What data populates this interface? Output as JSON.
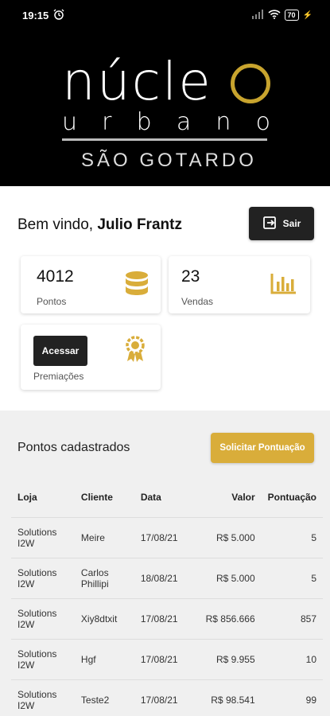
{
  "status_bar": {
    "time": "19:15",
    "battery": "70"
  },
  "logo": {
    "word": "núcle",
    "sub_letters": [
      "u",
      "r",
      "b",
      "a",
      "n",
      "o"
    ],
    "city": "SÃO GOTARDO"
  },
  "welcome": {
    "greeting": "Bem vindo,",
    "user_name": "Julio Frantz",
    "logout_label": "Sair"
  },
  "stats": [
    {
      "value": "4012",
      "label": "Pontos",
      "icon": "database-icon"
    },
    {
      "value": "23",
      "label": "Vendas",
      "icon": "bar-chart-icon"
    }
  ],
  "rewards": {
    "button_label": "Acessar",
    "label": "Premiações",
    "icon": "award-icon"
  },
  "points": {
    "title": "Pontos cadastrados",
    "request_button": "Solicitar Pontuação",
    "columns": [
      "Loja",
      "Cliente",
      "Data",
      "Valor",
      "Pontuação"
    ],
    "rows": [
      {
        "loja": "Solutions I2W",
        "cliente": "Meire",
        "data": "17/08/21",
        "valor": "R$ 5.000",
        "pontuacao": "5"
      },
      {
        "loja": "Solutions I2W",
        "cliente": "Carlos Phillipi",
        "data": "18/08/21",
        "valor": "R$ 5.000",
        "pontuacao": "5"
      },
      {
        "loja": "Solutions I2W",
        "cliente": "Xiy8dtxit",
        "data": "17/08/21",
        "valor": "R$ 856.666",
        "pontuacao": "857"
      },
      {
        "loja": "Solutions I2W",
        "cliente": "Hgf",
        "data": "17/08/21",
        "valor": "R$ 9.955",
        "pontuacao": "10"
      },
      {
        "loja": "Solutions I2W",
        "cliente": "Teste2",
        "data": "17/08/21",
        "valor": "R$ 98.541",
        "pontuacao": "99"
      }
    ]
  },
  "colors": {
    "accent": "#d9ad3a",
    "dark": "#222222",
    "header_bg": "#000000"
  }
}
